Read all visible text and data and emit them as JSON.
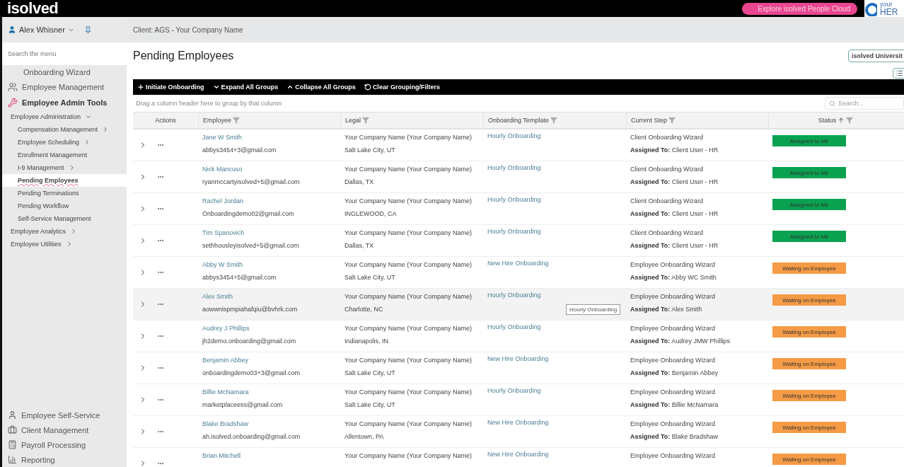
{
  "topbar": {
    "logo": "isolved",
    "promo": "Explore isolved People Cloud",
    "partner_line1": "your",
    "partner_line2": "HER"
  },
  "sidebar": {
    "user": "Alex Whisner",
    "search_placeholder": "Search the menu",
    "top_items": [
      {
        "label": "Onboarding Wizard",
        "kind": "plain"
      },
      {
        "label": "Employee Management",
        "kind": "people"
      },
      {
        "label": "Employee Admin Tools",
        "kind": "wrench"
      }
    ],
    "items": [
      {
        "label": "Employee Administration",
        "kind": "group",
        "expanded": true,
        "selected": false,
        "children": [
          {
            "label": "Compensation Management",
            "kind": "group",
            "expanded": false,
            "selected": false
          },
          {
            "label": "Employee Scheduling",
            "kind": "group",
            "expanded": false,
            "selected": false
          },
          {
            "label": "Enrollment Management",
            "kind": "link",
            "selected": false
          },
          {
            "label": "I-9 Management",
            "kind": "group",
            "expanded": false,
            "selected": false
          },
          {
            "label": "Pending Employees",
            "kind": "link",
            "selected": true
          },
          {
            "label": "Pending Terminations",
            "kind": "link",
            "selected": false
          },
          {
            "label": "Pending Workflow",
            "kind": "link",
            "selected": false
          },
          {
            "label": "Self-Service Management",
            "kind": "link",
            "selected": false
          }
        ]
      },
      {
        "label": "Employee Analytics",
        "kind": "group",
        "expanded": false,
        "selected": false
      },
      {
        "label": "Employee Utilities",
        "kind": "group",
        "expanded": false,
        "selected": false
      }
    ],
    "bottom_items": [
      {
        "label": "Employee Self-Service",
        "kind": "person"
      },
      {
        "label": "Client Management",
        "kind": "briefcase"
      },
      {
        "label": "Payroll Processing",
        "kind": "calculator"
      },
      {
        "label": "Reporting",
        "kind": "chart"
      }
    ]
  },
  "client_bar": "Client: AGS - Your Company Name",
  "page_title": "Pending Employees",
  "university_button": "isolved Universit",
  "toolbar": [
    {
      "label": "Initiate Onboarding",
      "kind": "plus"
    },
    {
      "label": "Expand All Groups",
      "kind": "down"
    },
    {
      "label": "Collapse All Groups",
      "kind": "up"
    },
    {
      "label": "Clear Grouping/Filters",
      "kind": "reset"
    }
  ],
  "group_hint": "Drag a column header here to group by that column",
  "search_placeholder": "Search...",
  "columns": [
    {
      "label": "Actions"
    },
    {
      "label": "Employee",
      "filter": true,
      "sorted": false
    },
    {
      "label": "Legal",
      "filter": true,
      "sorted": false
    },
    {
      "label": "Onboarding Template",
      "filter": true,
      "sorted": false
    },
    {
      "label": "Current Step",
      "filter": true,
      "sorted": false
    },
    {
      "label": "Status",
      "filter": true,
      "sorted": true
    }
  ],
  "rows": [
    {
      "name": "Jane W Smith",
      "email": "abbys3454+3@gmail.com",
      "legal": "Your Company Name (Your Company Name)",
      "city": "Salt Lake City, UT",
      "template": "Hourly Onboarding",
      "step": "Client Onboarding Wizard",
      "assigned_label": "Assigned To:",
      "assigned": "Client User - HR",
      "status": "Assigned to Me",
      "color": "#0aa251",
      "hovered": false
    },
    {
      "name": "Nick Mancuso",
      "email": "ryanmccartyisolved+5@gmail.com",
      "legal": "Your Company Name (Your Company Name)",
      "city": "Dallas, TX",
      "template": "Hourly Onboarding",
      "step": "Client Onboarding Wizard",
      "assigned_label": "Assigned To:",
      "assigned": "Client User - HR",
      "status": "Assigned to Me",
      "color": "#0aa251",
      "hovered": false
    },
    {
      "name": "Rachel Jordan",
      "email": "Onboardingdemo02@gmail.com",
      "legal": "Your Company Name (Your Company Name)",
      "city": "INGLEWOOD, CA",
      "template": "Hourly Onboarding",
      "step": "Client Onboarding Wizard",
      "assigned_label": "Assigned To:",
      "assigned": "Client User - HR",
      "status": "Assigned to Me",
      "color": "#0aa251",
      "hovered": false
    },
    {
      "name": "Tim Spanovich",
      "email": "sethhousleyisolved+5@gmail.com",
      "legal": "Your Company Name (Your Company Name)",
      "city": "Dallas, TX",
      "template": "Hourly Onboarding",
      "step": "Client Onboarding Wizard",
      "assigned_label": "Assigned To:",
      "assigned": "Client User - HR",
      "status": "Assigned to Me",
      "color": "#0aa251",
      "hovered": false
    },
    {
      "name": "Abby W Smith",
      "email": "abbys3454+5@gmail.com",
      "legal": "Your Company Name (Your Company Name)",
      "city": "Salt Lake City, UT",
      "template": "New Hire Onboarding",
      "step": "Employee Onboarding Wizard",
      "assigned_label": "Assigned To:",
      "assigned": "Abby WC Smith",
      "status": "Waiting on Employee",
      "color": "#f59a45",
      "hovered": false
    },
    {
      "name": "Alex Smith",
      "email": "aowwnispmpiahafqiu@bvhrk.com",
      "legal": "Your Company Name (Your Company Name)",
      "city": "Charlotte, NC",
      "template": "Hourly Onboarding",
      "step": "Employee Onboarding Wizard",
      "assigned_label": "Assigned To:",
      "assigned": "Alex Smith",
      "status": "Waiting on Employee",
      "color": "#f59a45",
      "hovered": true,
      "tooltip": "Hourly Onboarding"
    },
    {
      "name": "Audrey J Phillips",
      "email": "jh2demo.onboarding@gmail.com",
      "legal": "Your Company Name (Your Company Name)",
      "city": "Indianapolis, IN",
      "template": "Hourly Onboarding",
      "step": "Employee Onboarding Wizard",
      "assigned_label": "Assigned To:",
      "assigned": "Audrey JMW Phillips",
      "status": "Waiting on Employee",
      "color": "#f59a45",
      "hovered": false
    },
    {
      "name": "Benjamin Abbey",
      "email": "onboardingdemo03+3@gmail.com",
      "legal": "Your Company Name (Your Company Name)",
      "city": "Salt Lake City, UT",
      "template": "New Hire Onboarding",
      "step": "Employee Onboarding Wizard",
      "assigned_label": "Assigned To:",
      "assigned": "Benjamin Abbey",
      "status": "Waiting on Employee",
      "color": "#f59a45",
      "hovered": false
    },
    {
      "name": "Billie McNamara",
      "email": "marketplaceess@gmail.com",
      "legal": "Your Company Name (Your Company Name)",
      "city": "Salt Lake City, UT",
      "template": "Hourly Onboarding",
      "step": "Employee Onboarding Wizard",
      "assigned_label": "Assigned To:",
      "assigned": "Billie McNamara",
      "status": "Waiting on Employee",
      "color": "#f59a45",
      "hovered": false
    },
    {
      "name": "Blake Bradshaw",
      "email": "ah.isolved.onboarding@gmail.com",
      "legal": "Your Company Name (Your Company Name)",
      "city": "Allentown, PA",
      "template": "New Hire Onboarding",
      "step": "Employee Onboarding Wizard",
      "assigned_label": "Assigned To:",
      "assigned": "Blake Bradshaw",
      "status": "Waiting on Employee",
      "color": "#f59a45",
      "hovered": false
    },
    {
      "name": "Brian Mitchell",
      "legal": "Your Company Name (Your Company Name)",
      "template": "New Hire Onboarding",
      "step": "Employee Onboarding Wizard",
      "status": "Waiting on Employee",
      "color": "#f59a45",
      "hovered": false
    }
  ]
}
